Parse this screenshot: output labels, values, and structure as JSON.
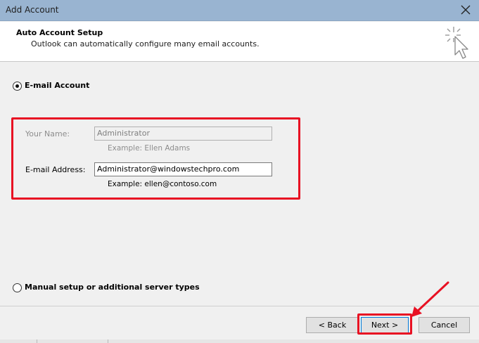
{
  "window": {
    "title": "Add Account",
    "close_icon": "close-icon"
  },
  "header": {
    "title": "Auto Account Setup",
    "subtitle": "Outlook can automatically configure many email accounts.",
    "icon": "setup-wand-icon"
  },
  "email_account": {
    "radio_label": "E-mail Account",
    "selected": true,
    "your_name": {
      "label": "Your Name:",
      "value": "Administrator",
      "example": "Example: Ellen Adams",
      "disabled": true
    },
    "email_address": {
      "label": "E-mail Address:",
      "value": "Administrator@windowstechpro.com",
      "example": "Example: ellen@contoso.com"
    }
  },
  "manual_setup": {
    "radio_label": "Manual setup or additional server types",
    "selected": false
  },
  "buttons": {
    "back": "< Back",
    "next": "Next >",
    "cancel": "Cancel"
  },
  "annotation": {
    "color": "#e81123"
  }
}
